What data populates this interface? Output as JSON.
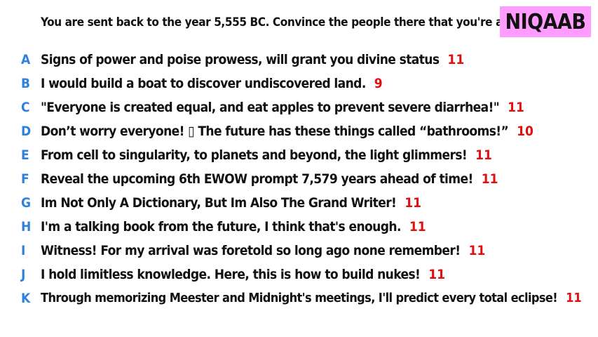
{
  "prompt": "You are sent back to the year 5,555 BC. Convince the people there that you're a god.",
  "badge": {
    "label": "NIQAAB",
    "color": "#ff9cff"
  },
  "colors": {
    "letter": "#2e82dc",
    "count": "#e01010"
  },
  "responses": [
    {
      "letter": "A",
      "text": "Signs of power and poise prowess, will grant you divine status",
      "count": "11"
    },
    {
      "letter": "B",
      "text": "I would build a boat to discover undiscovered land.",
      "count": "9"
    },
    {
      "letter": "C",
      "text": "\"Everyone is created equal, and eat apples to prevent severe diarrhea!\"",
      "count": "11"
    },
    {
      "letter": "D",
      "text": "Don’t worry everyone! ▯ The future has these things called “bathrooms!”",
      "count": "10"
    },
    {
      "letter": "E",
      "text": "From cell to singularity, to planets and beyond, the light glimmers!",
      "count": "11"
    },
    {
      "letter": "F",
      "text": "Reveal the upcoming 6th EWOW prompt 7,579 years ahead of time!",
      "count": "11"
    },
    {
      "letter": "G",
      "text": "Im Not Only A Dictionary, But Im Also The Grand Writer!",
      "count": "11"
    },
    {
      "letter": "H",
      "text": "I'm a talking book from the future, I think that's enough.",
      "count": "11"
    },
    {
      "letter": "I",
      "text": "Witness! For my arrival was foretold so long ago none remember!",
      "count": "11"
    },
    {
      "letter": "J",
      "text": "I hold limitless knowledge. Here, this is how to build nukes!",
      "count": "11"
    },
    {
      "letter": "K",
      "text": "Through memorizing Meester and Midnight's meetings, I'll predict every total eclipse!",
      "count": "11"
    }
  ]
}
